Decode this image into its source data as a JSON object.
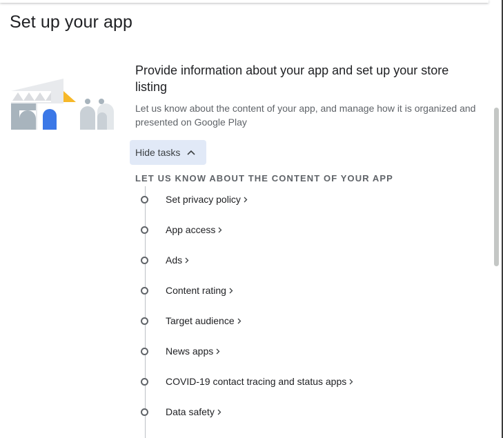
{
  "page": {
    "title": "Set up your app"
  },
  "section": {
    "heading": "Provide information about your app and set up your store listing",
    "description": "Let us know about the content of your app, and manage how it is organized and presented on Google Play",
    "toggle_label": "Hide tasks",
    "toggle_icon": "chevron-up-icon"
  },
  "task_group": {
    "label": "LET US KNOW ABOUT THE CONTENT OF YOUR APP",
    "tasks": [
      {
        "label": "Set privacy policy"
      },
      {
        "label": "App access"
      },
      {
        "label": "Ads"
      },
      {
        "label": "Content rating"
      },
      {
        "label": "Target audience"
      },
      {
        "label": "News apps"
      },
      {
        "label": "COVID-19 contact tracing and status apps"
      },
      {
        "label": "Data safety"
      }
    ]
  },
  "colors": {
    "accent_blue": "#3b78e7",
    "accent_yellow": "#f6b829",
    "toggle_bg": "#e1e9f7"
  }
}
